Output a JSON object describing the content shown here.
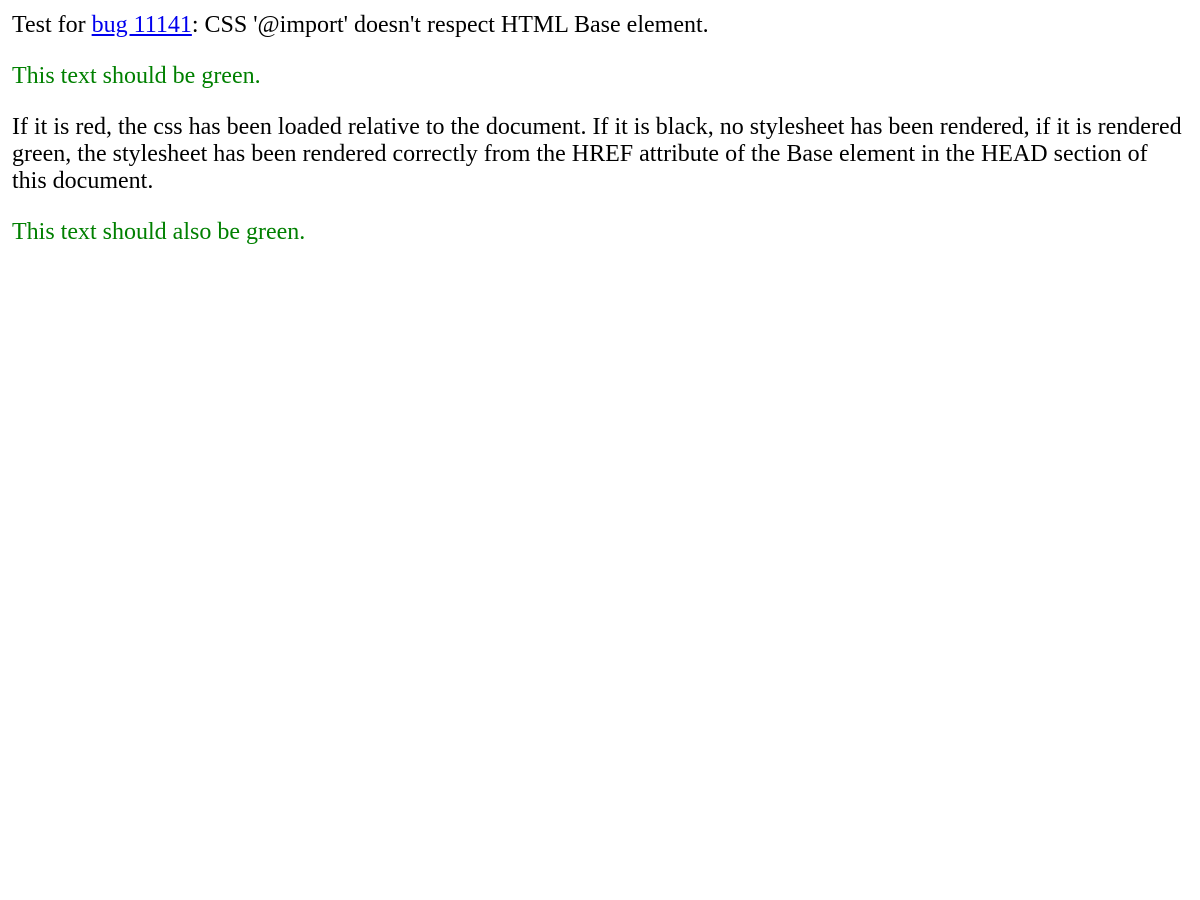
{
  "intro": {
    "prefix": "Test for ",
    "link_text": "bug 11141",
    "suffix": ": CSS '@import' doesn't respect HTML Base element."
  },
  "green_line_1": "This text should be green.",
  "explanation": "If it is red, the css has been loaded relative to the document. If it is black, no stylesheet has been rendered, if it is rendered green, the stylesheet has been rendered correctly from the HREF attribute of the Base element in the HEAD section of this document.",
  "green_line_2": "This text should also be green.",
  "colors": {
    "link": "#0000ee",
    "green": "#008000",
    "text": "#000000"
  }
}
